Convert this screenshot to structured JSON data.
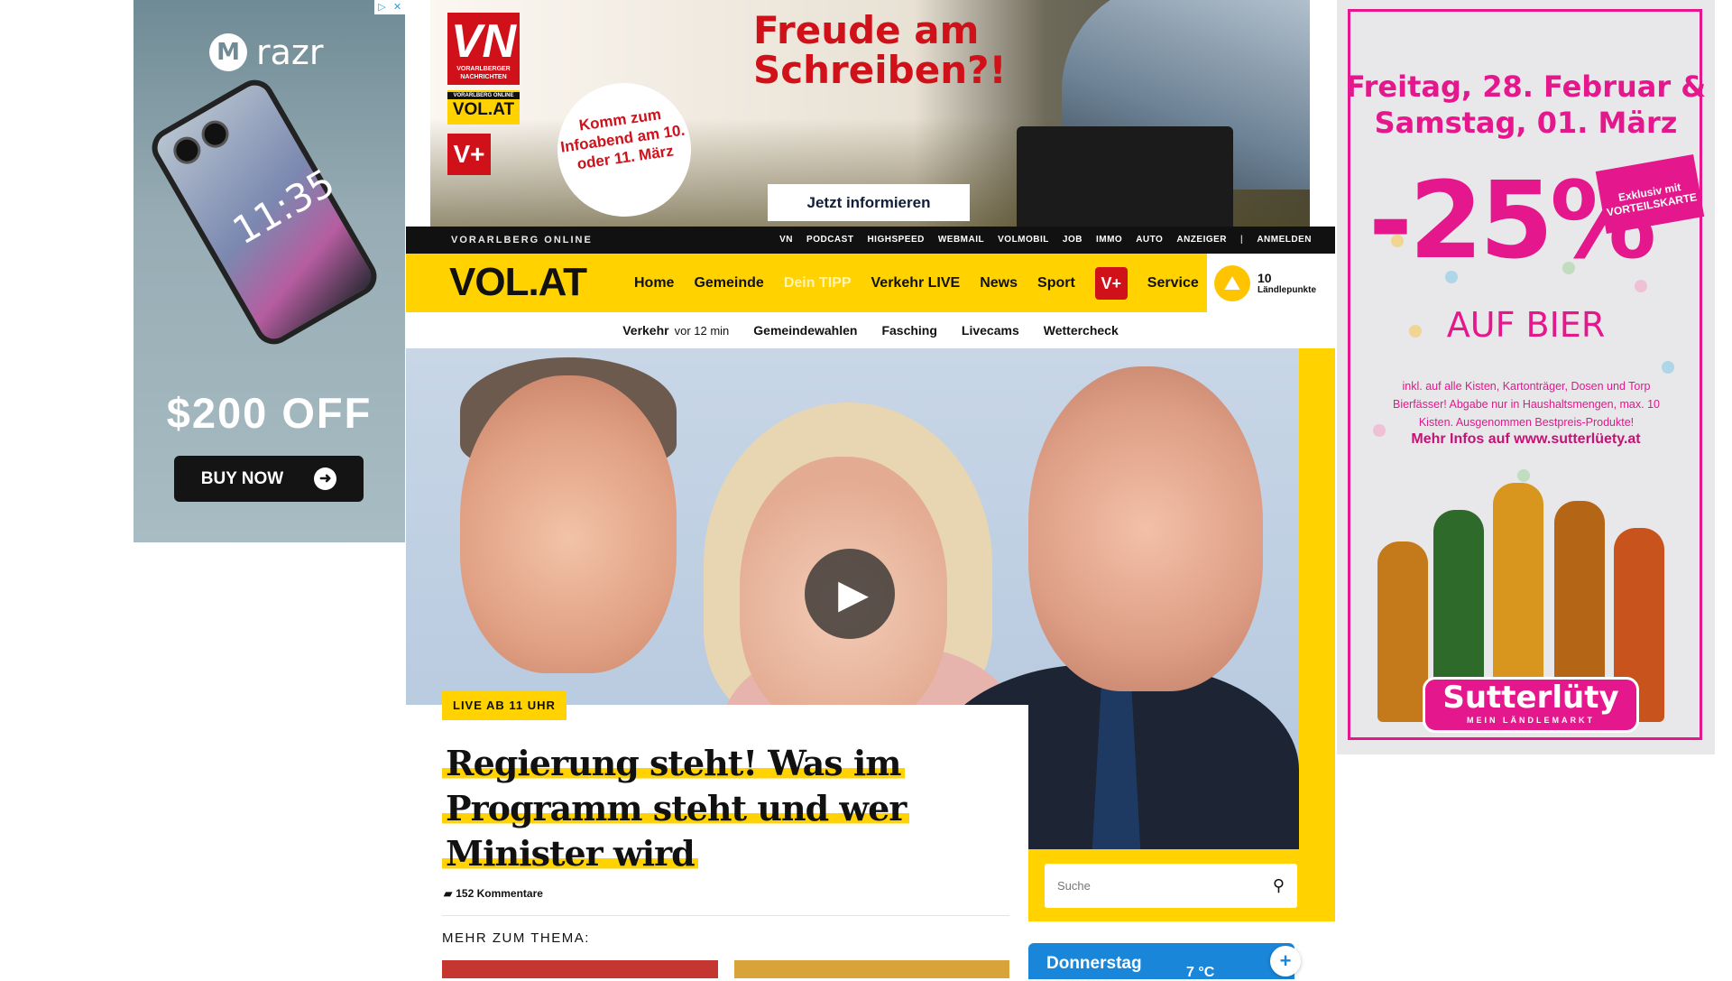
{
  "ad_left": {
    "brand": "razr",
    "clock": "11:35",
    "offer": "$200 OFF",
    "cta": "BUY NOW"
  },
  "ad_top": {
    "logo_vn": "VN",
    "logo_vn_sub": "VORARLBERGER NACHRICHTEN",
    "logo_volat_sub": "VORARLBERG ONLINE",
    "logo_volat": "VOL.AT",
    "logo_vplus": "V+",
    "headline_line1": "Freude am",
    "headline_line2": "Schreiben?!",
    "circle_text": "Komm zum Infoabend am 10. oder 11. März",
    "cta": "Jetzt informieren"
  },
  "topbar": {
    "brandline": "VORARLBERG ONLINE",
    "links": [
      "VN",
      "PODCAST",
      "HIGHSPEED",
      "WEBMAIL",
      "VOLMOBIL",
      "JOB",
      "IMMO",
      "AUTO",
      "ANZEIGER"
    ],
    "separator": "|",
    "login": "ANMELDEN"
  },
  "nav": {
    "logo": "VOL.AT",
    "items": [
      "Home",
      "Gemeinde",
      "Dein TIPP",
      "Verkehr LIVE",
      "News",
      "Sport"
    ],
    "vplus": "V+",
    "service": "Service",
    "points_value": "10",
    "points_label": "Ländlepunkte"
  },
  "subnav": {
    "verkehr": "Verkehr",
    "verkehr_time": "vor 12 min",
    "items": [
      "Gemeindewahlen",
      "Fasching",
      "Livecams",
      "Wettercheck"
    ]
  },
  "article": {
    "badge": "LIVE AB 11 UHR",
    "title_line1": "Regierung steht! Was im",
    "title_line2": "Programm steht und wer",
    "title_line3": "Minister wird",
    "comments": "152 Kommentare",
    "more_label": "MEHR ZUM THEMA:"
  },
  "search": {
    "placeholder": "Suche"
  },
  "weather": {
    "day": "Donnerstag",
    "temp": "7 °C",
    "plus": "+"
  },
  "ad_right": {
    "dates_line1": "Freitag, 28. Februar &",
    "dates_line2": "Samstag, 01. März",
    "discount": "-25%",
    "card_text": "Exklusiv mit VORTEILSKARTE",
    "product": "AUF BIER",
    "fineprint": "inkl. auf alle Kisten, Kartonträger, Dosen und Torp Bierfässer! Abgabe nur in Haushaltsmengen, max. 10 Kisten. Ausgenommen Bestpreis-Produkte!",
    "url": "Mehr Infos auf www.sutterlüety.at",
    "logo_name": "Sutterlüty",
    "logo_tag": "MEIN LÄNDLEMARKT"
  },
  "colors": {
    "volat_yellow": "#ffd200",
    "dark": "#111111",
    "vn_red": "#d0111a",
    "sutterluety_pink": "#e4178c",
    "weather_blue": "#1a86d9"
  }
}
